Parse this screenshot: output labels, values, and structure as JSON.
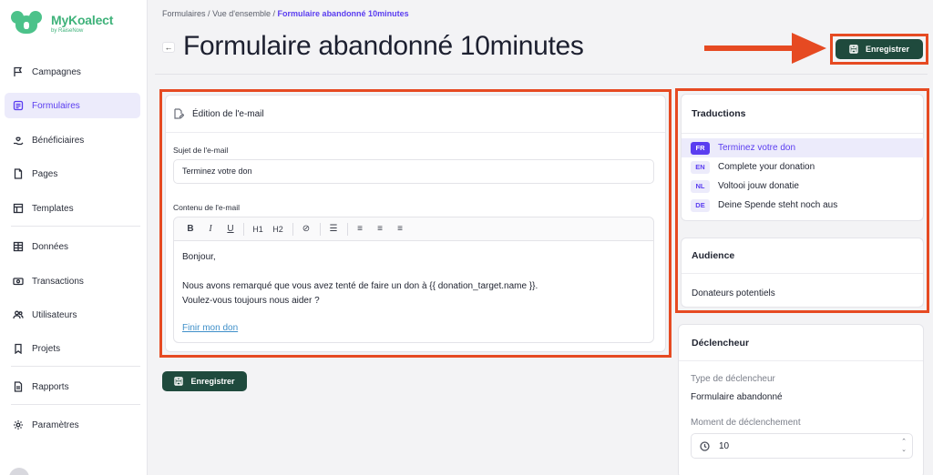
{
  "app": {
    "name": "MyKoalect",
    "sub": "by RaiseNow"
  },
  "sidebar": {
    "items": [
      {
        "label": "Campagnes",
        "icon": "flag-icon"
      },
      {
        "label": "Formulaires",
        "icon": "form-icon"
      },
      {
        "label": "Bénéficiaires",
        "icon": "hand-heart-icon"
      },
      {
        "label": "Pages",
        "icon": "page-icon"
      },
      {
        "label": "Templates",
        "icon": "template-icon"
      },
      {
        "label": "Données",
        "icon": "table-icon"
      },
      {
        "label": "Transactions",
        "icon": "money-icon"
      },
      {
        "label": "Utilisateurs",
        "icon": "users-icon"
      },
      {
        "label": "Projets",
        "icon": "bookmark-icon"
      },
      {
        "label": "Rapports",
        "icon": "report-icon"
      },
      {
        "label": "Paramètres",
        "icon": "gear-icon"
      }
    ],
    "active": "Formulaires"
  },
  "breadcrumb": {
    "part1": "Formulaires",
    "sep": "/",
    "part2": "Vue d'ensemble",
    "current": "Formulaire abandonné 10minutes"
  },
  "header": {
    "title": "Formulaire abandonné 10minutes",
    "back": "←",
    "save_label": "Enregistrer"
  },
  "email_editor": {
    "title": "Édition de l'e-mail",
    "subject_label": "Sujet de l'e-mail",
    "subject_value": "Terminez votre don",
    "content_label": "Contenu de l'e-mail",
    "toolbar": {
      "bold": "B",
      "italic": "I",
      "underline": "U",
      "h1": "H1",
      "h2": "H2",
      "link": "⊘",
      "list": "☰",
      "align_left": "≡",
      "align_center": "≡",
      "align_right": "≡"
    },
    "body": {
      "greeting": "Bonjour,",
      "line1": "Nous avons remarqué que vous avez tenté de faire un don à {{ donation_target.name }}.",
      "line2": "Voulez-vous toujours nous aider ?",
      "link": "Finir mon don"
    },
    "save_label": "Enregistrer"
  },
  "translations": {
    "title": "Traductions",
    "items": [
      {
        "code": "FR",
        "text": "Terminez votre don",
        "active": true
      },
      {
        "code": "EN",
        "text": "Complete your donation"
      },
      {
        "code": "NL",
        "text": "Voltooi jouw donatie"
      },
      {
        "code": "DE",
        "text": "Deine Spende steht noch aus"
      }
    ]
  },
  "audience": {
    "title": "Audience",
    "value": "Donateurs potentiels"
  },
  "trigger": {
    "title": "Déclencheur",
    "type_label": "Type de déclencheur",
    "type_value": "Formulaire abandonné",
    "moment_label": "Moment de déclenchement",
    "moment_value": "10"
  },
  "colors": {
    "accent": "#5a3df0",
    "primary_button": "#1f4a3d",
    "highlight": "#e64a22",
    "brand": "#3fb27a"
  }
}
